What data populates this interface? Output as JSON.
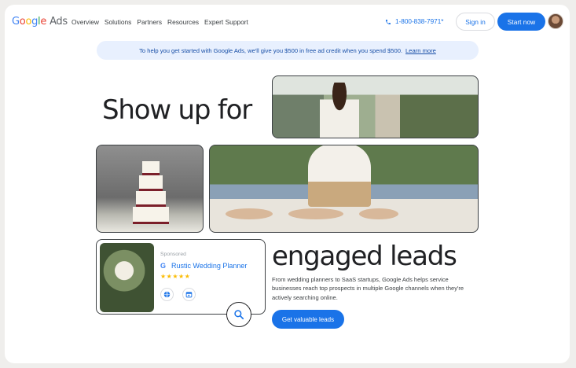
{
  "header": {
    "logo_google": [
      "G",
      "o",
      "o",
      "g",
      "l",
      "e"
    ],
    "logo_ads": "Ads",
    "nav": [
      "Overview",
      "Solutions",
      "Partners",
      "Resources",
      "Expert Support"
    ],
    "phone": "1-800-838-7971*",
    "signin_label": "Sign in",
    "start_label": "Start now"
  },
  "banner": {
    "text": "To help you get started with Google Ads, we'll give you $500 in free ad credit when you spend $500.",
    "link": "Learn more"
  },
  "hero": {
    "headline_part1": "Show up for",
    "headline_part2": "engaged leads",
    "description": "From wedding planners to SaaS startups, Google Ads helps service businesses reach top prospects in multiple Google channels when they're actively searching online.",
    "cta_label": "Get valuable leads"
  },
  "ad": {
    "sponsored": "Sponsored",
    "title": "Rustic Wedding Planner",
    "stars": "★★★★★",
    "rating": 5
  },
  "colors": {
    "primary": "#1a73e8",
    "banner_bg": "#e8f0fe",
    "star": "#fbbc04"
  }
}
